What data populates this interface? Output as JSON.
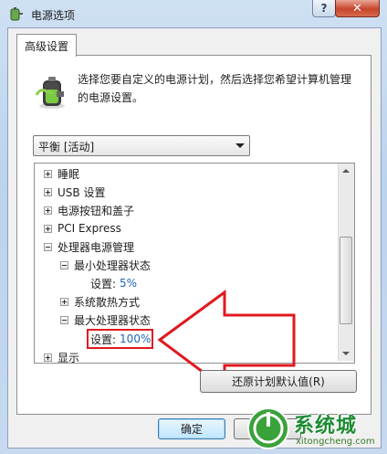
{
  "window": {
    "title": "电源选项",
    "help_label": "?",
    "close_label": "✕"
  },
  "tabs": [
    {
      "label": "高级设置"
    }
  ],
  "description": "选择您要自定义的电源计划，然后选择您希望计算机管理的电源设置。",
  "plan_select": {
    "value": "平衡 [活动]"
  },
  "tree": {
    "nodes": [
      {
        "label": "睡眠",
        "expander": "plus"
      },
      {
        "label": "USB 设置",
        "expander": "plus"
      },
      {
        "label": "电源按钮和盖子",
        "expander": "plus"
      },
      {
        "label": "PCI Express",
        "expander": "plus"
      },
      {
        "label": "处理器电源管理",
        "expander": "minus"
      },
      {
        "label": "最小处理器状态",
        "expander": "minus"
      },
      {
        "label": "设置:",
        "value": "5%"
      },
      {
        "label": "系统散热方式",
        "expander": "plus"
      },
      {
        "label": "最大处理器状态",
        "expander": "minus"
      },
      {
        "label": "设置:",
        "value": "100%"
      },
      {
        "label": "显示",
        "expander": "plus"
      }
    ]
  },
  "buttons": {
    "restore_defaults": "还原计划默认值(R)",
    "ok": "确定",
    "cancel": ""
  },
  "watermark": {
    "text": "系统城",
    "url": "xitongcheng.com"
  },
  "colors": {
    "highlight": "#e0191f",
    "value_blue": "#1f64b6",
    "watermark_green": "#1f8c34"
  },
  "icons": [
    "power-options-icon",
    "battery-plug-icon",
    "dropdown-arrow-icon",
    "scroll-up-icon",
    "scroll-down-icon",
    "red-arrow-annotation-icon",
    "watermark-logo-icon"
  ]
}
